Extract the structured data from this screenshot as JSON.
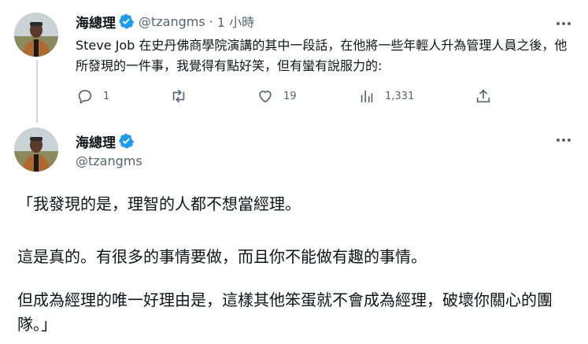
{
  "tweet1": {
    "display_name": "海總理",
    "handle": "@tzangms",
    "separator": "·",
    "time": "1 小時",
    "text": "Steve Job 在史丹佛商學院演講的其中一段話，在他將一些年輕人升為管理人員之後，他所發現的一件事，我覺得有點好笑，但有蠻有說服力的:",
    "actions": {
      "reply_count": "1",
      "retweet_count": "",
      "like_count": "19",
      "views_count": "1,331"
    }
  },
  "tweet2": {
    "display_name": "海總理",
    "handle": "@tzangms",
    "paragraphs": [
      "「我發現的是，理智的人都不想當經理。",
      "這是真的。有很多的事情要做，而且你不能做有趣的事情。",
      "但成為經理的唯一好理由是，這樣其他笨蛋就不會成為經理，破壞你關心的團隊。」"
    ]
  },
  "colors": {
    "text": "#0f1419",
    "muted": "#536471",
    "verified": "#1d9bf0",
    "thread_line": "#cfd9de"
  },
  "icons": {
    "verified": "verified-badge-icon",
    "more": "more-options-icon",
    "reply": "reply-icon",
    "retweet": "retweet-icon",
    "like": "heart-icon",
    "views": "views-chart-icon",
    "share": "share-icon"
  }
}
